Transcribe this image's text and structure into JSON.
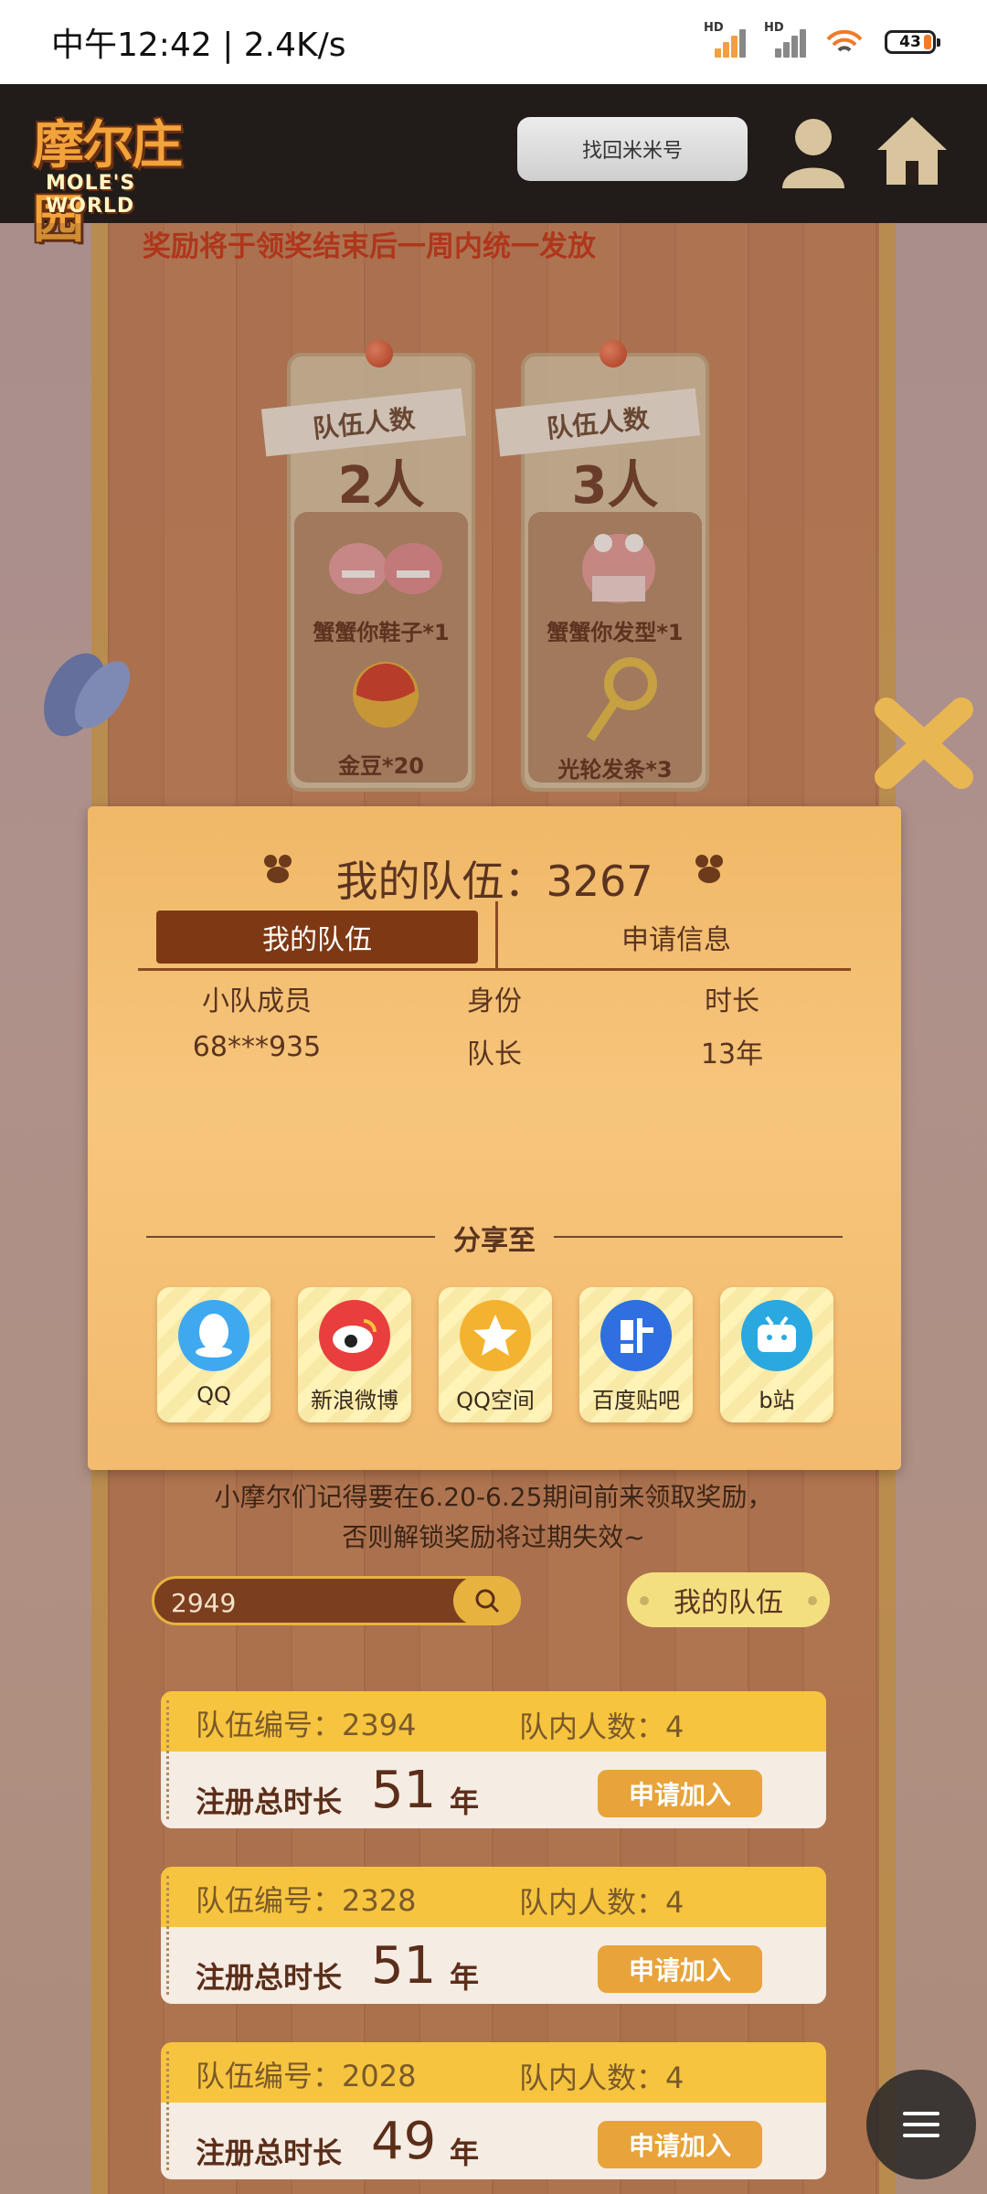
{
  "status_bar": {
    "time": "中午12:42 | 2.4K/s",
    "battery": "43"
  },
  "header": {
    "logo_cn": "摩尔庄园",
    "logo_en": "MOLE'S WORLD",
    "find_button": "找回米米号"
  },
  "notice": "奖励将于领奖结束后一周内统一发放",
  "reward_cards": [
    {
      "tag": "队伍人数",
      "count": "2人",
      "items": [
        "蟹蟹你鞋子*1",
        "金豆*20"
      ]
    },
    {
      "tag": "队伍人数",
      "count": "3人",
      "items": [
        "蟹蟹你发型*1",
        "光轮发条*3"
      ]
    }
  ],
  "modal": {
    "title": "我的队伍：3267",
    "tabs": [
      "我的队伍",
      "申请信息"
    ],
    "columns": [
      "小队成员",
      "身份",
      "时长"
    ],
    "rows": [
      [
        "68***935",
        "队长",
        "13年"
      ]
    ],
    "share_label": "分享至",
    "share_targets": [
      "QQ",
      "新浪微博",
      "QQ空间",
      "百度贴吧",
      "b站"
    ]
  },
  "reminder_line1": "小摩尔们记得要在6.20-6.25期间前来领取奖励，",
  "reminder_line2": "否则解锁奖励将过期失效~",
  "search": {
    "value": "2949"
  },
  "my_team_button": "我的队伍",
  "team_list": [
    {
      "team_no": "队伍编号：2394",
      "member_count": "队内人数：4",
      "reg_label": "注册总时长",
      "years": "51",
      "unit": "年",
      "join": "申请加入"
    },
    {
      "team_no": "队伍编号：2328",
      "member_count": "队内人数：4",
      "reg_label": "注册总时长",
      "years": "51",
      "unit": "年",
      "join": "申请加入"
    },
    {
      "team_no": "队伍编号：2028",
      "member_count": "队内人数：4",
      "reg_label": "注册总时长",
      "years": "49",
      "unit": "年",
      "join": "申请加入"
    }
  ],
  "colors": {
    "accent": "#7e3914",
    "gold": "#e7b33e",
    "notice_red": "#c93a1c"
  }
}
